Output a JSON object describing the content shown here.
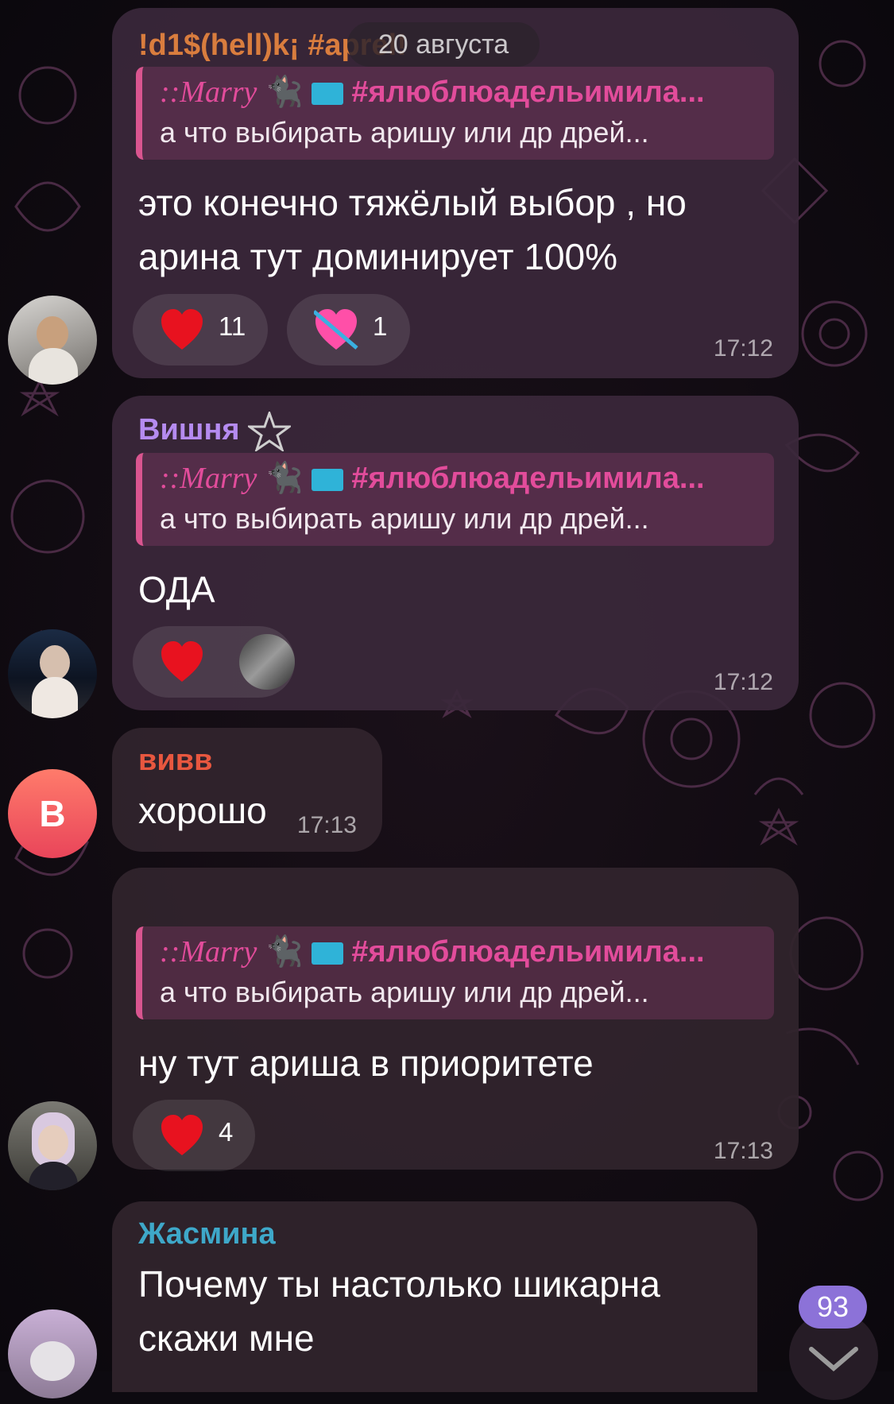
{
  "date_badge": "20 августа",
  "unread_count": "93",
  "messages": [
    {
      "sender": "!d1$(hell)k¡ #aprel!",
      "sender_color": "#d97d3e",
      "reply": {
        "name_script": "::Marry",
        "name_tag": "#ялюблюадельимила...",
        "text": "а что выбирать аришу или др дрей..."
      },
      "lines": [
        "это конечно тяжёлый выбор , но",
        "арина тут доминирует 100%"
      ],
      "reactions": [
        {
          "emoji": "heart-icon",
          "count": "11"
        },
        {
          "emoji": "heart-with-arrow-icon",
          "count": "1"
        }
      ],
      "time": "17:12"
    },
    {
      "sender": "Вишня",
      "sender_color": "#b58bf0",
      "reply": {
        "name_script": "::Marry",
        "name_tag": "#ялюблюадельимила...",
        "text": "а что выбирать аришу или др дрей..."
      },
      "lines": [
        "ОДА"
      ],
      "reactions": [
        {
          "emoji": "heart-icon",
          "count": ""
        }
      ],
      "time": "17:12"
    },
    {
      "sender": "вивв",
      "sender_color": "#e8573f",
      "avatar_letter": "В",
      "lines": [
        "хорошо"
      ],
      "time": "17:13"
    },
    {
      "reply": {
        "name_script": "::Marry",
        "name_tag": "#ялюблюадельимила...",
        "text": "а что выбирать аришу или др дрей..."
      },
      "lines": [
        "ну тут ариша в приоритете"
      ],
      "reactions": [
        {
          "emoji": "heart-icon",
          "count": "4"
        }
      ],
      "time": "17:13"
    },
    {
      "sender": "Жасмина",
      "sender_color": "#3ea8c9",
      "lines": [
        "Почему ты настолько шикарна",
        "скажи мне"
      ]
    }
  ]
}
